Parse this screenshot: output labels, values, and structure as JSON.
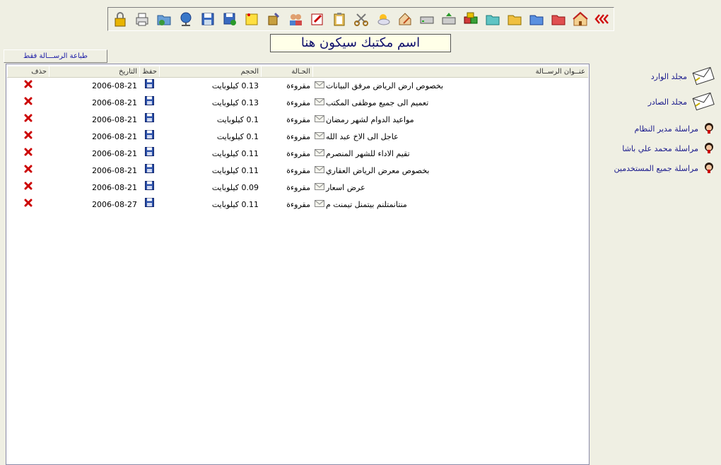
{
  "title": "اسم مكتبك سيكون هنا",
  "print_button": "طباعة الرســـالة فقط",
  "toolbar": {
    "icons": [
      "lock-icon",
      "printer-icon",
      "folder-sync-icon",
      "network-icon",
      "floppy-icon",
      "save-icon",
      "sticky-note-icon",
      "tools-icon",
      "users-icon",
      "edit-icon",
      "clipboard-icon",
      "scissors-icon",
      "weather-icon",
      "home-edit-icon",
      "drive-icon",
      "drive-upload-icon",
      "boxes-icon",
      "folder-teal-icon",
      "folder-yellow-icon",
      "folder-blue-icon",
      "folder-red-icon",
      "home-icon",
      "back-arrows-icon"
    ]
  },
  "table": {
    "headers": {
      "title": "عنــوان الرســالة",
      "status": "الحـالة",
      "size": "الحجم",
      "save": "حفظ",
      "date": "التاريخ",
      "delete": "حذف"
    },
    "rows": [
      {
        "title": "بخصوص ارض الرياض مرفق البيانات",
        "status": "مقروءة",
        "size": "0.13 كيلوبايت",
        "date": "2006-08-21"
      },
      {
        "title": "تعميم الى جميع موظفى المكتب",
        "status": "مقروءة",
        "size": "0.13 كيلوبايت",
        "date": "2006-08-21"
      },
      {
        "title": "مواعيد الدوام لشهر رمضان",
        "status": "مقروءة",
        "size": "0.1 كيلوبايت",
        "date": "2006-08-21"
      },
      {
        "title": "عاجل الى الاخ عبد الله",
        "status": "مقروءة",
        "size": "0.1 كيلوبايت",
        "date": "2006-08-21"
      },
      {
        "title": "تقيم الاداء للشهر المنصرم",
        "status": "مقروءة",
        "size": "0.11 كيلوبايت",
        "date": "2006-08-21"
      },
      {
        "title": "بخصوص معرض الرياض العقاري",
        "status": "مقروءة",
        "size": "0.11 كيلوبايت",
        "date": "2006-08-21"
      },
      {
        "title": "عرض اسعار",
        "status": "مقروءة",
        "size": "0.09 كيلوبايت",
        "date": "2006-08-21"
      },
      {
        "title": "منتانمتلنم بيتمنل تيمنت م",
        "status": "مقروءة",
        "size": "0.11 كيلوبايت",
        "date": "2006-08-27"
      }
    ]
  },
  "sidebar": {
    "folders": [
      {
        "label": "مجلد الوارد",
        "icon": "inbox-envelope-icon"
      },
      {
        "label": "مجلد الصادر",
        "icon": "outbox-envelope-icon"
      }
    ],
    "contacts": [
      {
        "label": "مراسلة مدير النظام",
        "icon": "person-icon"
      },
      {
        "label": "مراسلة محمد علي باشا",
        "icon": "person-icon"
      },
      {
        "label": "مراسلة جميع المستخدمين",
        "icon": "person-icon"
      }
    ]
  },
  "colors": {
    "background": "#efefe3",
    "title_text": "#0d0d6b",
    "link": "#1a1a8c",
    "delete": "#cc0000"
  }
}
